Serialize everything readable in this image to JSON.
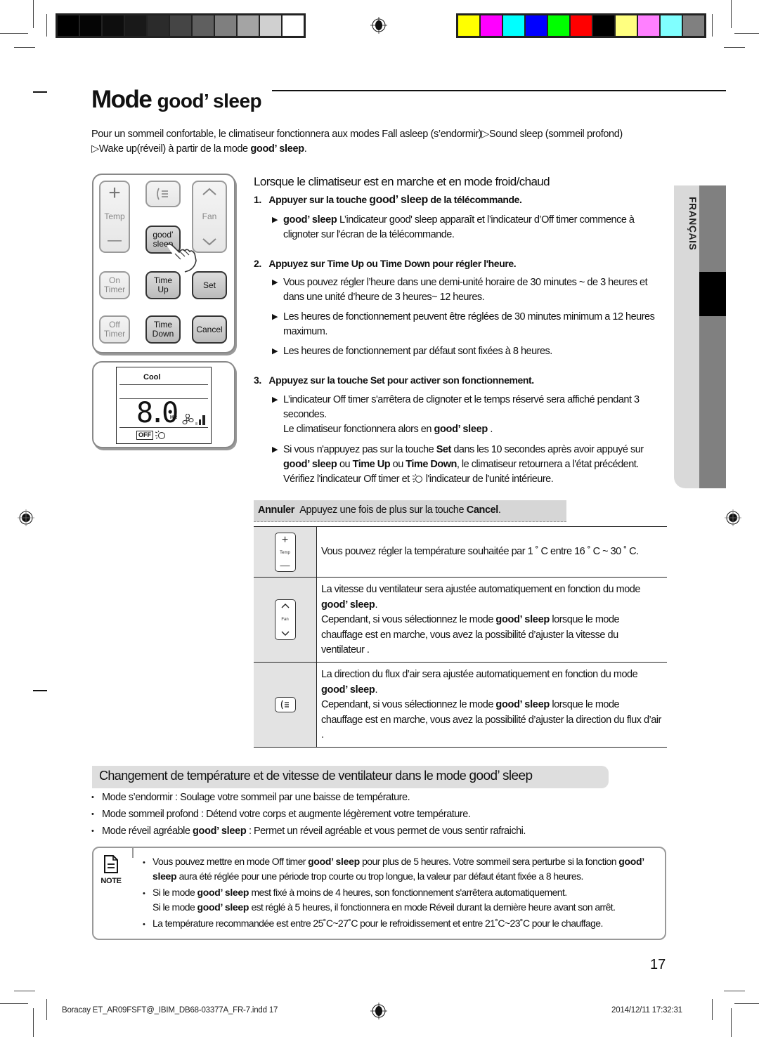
{
  "print_marks": {
    "grayscale_bar": [
      "#000000",
      "#050505",
      "#0e0e0e",
      "#191919",
      "#2b2b2b",
      "#454545",
      "#5f5f5f",
      "#7f7f7f",
      "#a4a4a4",
      "#d0d0d0",
      "#ffffff"
    ],
    "color_bar": [
      "#ffff00",
      "#ff00ff",
      "#00ffff",
      "#0000ff",
      "#00ff00",
      "#ff0000",
      "#000000",
      "#ffff80",
      "#ff80ff",
      "#80ffff",
      "#808080"
    ]
  },
  "title": {
    "prefix": "Mode",
    "brand": "good’ sleep"
  },
  "intro": {
    "text1": "Pour un sommeil confortable, le climatiseur fonctionnera aux modes Fall asleep (s’endormir)",
    "arrow": "▷",
    "text2": "Sound sleep (sommeil profond)",
    "text3": "Wake up(réveil) à partir de la mode ",
    "brand": "good’ sleep",
    "end": "."
  },
  "remote": {
    "buttons": {
      "temp_plus": "+",
      "temp_label": "Temp",
      "temp_minus": "—",
      "swing_symbol": "⟬≋",
      "fan_up": "⌃",
      "fan_label": "Fan",
      "fan_down": "⌄",
      "good_sleep_line1": "good’",
      "good_sleep_line2": "sleep",
      "on_timer_line1": "On",
      "on_timer_line2": "Timer",
      "time_up_line1": "Time",
      "time_up_line2": "Up",
      "set": "Set",
      "off_timer_line1": "Off",
      "off_timer_line2": "Timer",
      "time_down_line1": "Time",
      "time_down_line2": "Down",
      "cancel": "Cancel"
    },
    "display": {
      "mode": "Cool",
      "value": "8.0",
      "unit": "HR",
      "off_badge": "OFF"
    }
  },
  "side_tab": {
    "label": "FRANÇAIS"
  },
  "section1": {
    "heading": "Lorsque le climatiseur est en marche et en mode froid/chaud",
    "steps": [
      {
        "num": "1.",
        "pre": "Appuyer sur la touche ",
        "brand": "good’ sleep",
        "post": " de la télécommande.",
        "bullets": [
          {
            "brand": "good’ sleep",
            "text": " L’indicateur good' sleep apparaît et  l’indicateur d’Off timer commence à clignoter sur l'écran de la télécommande."
          }
        ]
      },
      {
        "num": "2.",
        "text": "Appuyez sur Time Up ou Time Down pour régler l'heure.",
        "bullets": [
          {
            "text": "Vous pouvez régler l’heure dans une demi-unité horaire de 30 minutes ~ de 3 heures et dans une unité d’heure de 3 heures~ 12 heures."
          },
          {
            "text": "Les heures de fonctionnement peuvent être réglées de 30 minutes minimum a 12 heures maximum."
          },
          {
            "text": "Les heures de fonctionnement par défaut sont fixées à 8 heures."
          }
        ]
      },
      {
        "num": "3.",
        "text": "Appuyez sur la touche Set pour activer son fonctionnement.",
        "bullets": [
          {
            "text": "L’indicateur Off timer s'arrêtera de clignoter et le temps réservé sera affiché pendant 3 secondes.",
            "line2_pre": "Le climatiseur fonctionnera alors en ",
            "line2_brand": "good’ sleep",
            "line2_post": " ."
          },
          {
            "p1": "Si vous n'appuyez pas sur la touche ",
            "b1": "Set",
            "p2": " dans les 10 secondes après avoir appuyé sur ",
            "brand": "good’ sleep",
            "p3": " ou ",
            "b2": "Time Up",
            "p4": " ou ",
            "b3": "Time Down",
            "p5": ", le climatiseur retournera a l'état précédent. Vérifiez l'indicateur Off timer et ",
            "p6": " l'indicateur de l'unité intérieure."
          }
        ]
      }
    ]
  },
  "cancel_note": {
    "label": "Annuler",
    "pre": "Appuyez une fois de plus sur la touche ",
    "bold": "Cancel",
    "post": "."
  },
  "table": {
    "rows": [
      {
        "icon": "temp-button-icon",
        "icon_label": "Temp",
        "text": "Vous pouvez régler la température souhaitée par 1 ˚ C entre 16 ˚ C ~ 30 ˚ C."
      },
      {
        "icon": "fan-button-icon",
        "icon_label": "Fan",
        "a": "La vitesse du ventilateur sera ajustée automatiquement en fonction du mode ",
        "brand": "good’ sleep",
        "b": ".",
        "c": "Cependant, si vous sélectionnez le mode ",
        "d": " lorsque le mode chauffage est en marche, vous avez la possibilité d’ajuster la vitesse du ventilateur ."
      },
      {
        "icon": "swing-button-icon",
        "a": "La direction du flux d’air sera ajustée automatiquement en fonction du mode ",
        "brand": "good’ sleep",
        "b": ".",
        "c": "Cependant, si vous sélectionnez le mode ",
        "d": " lorsque le mode chauffage est en marche, vous avez la possibilité d’ajuster la direction du flux d’air ."
      }
    ]
  },
  "section2": {
    "heading": "Changement de température et de vitesse de ventilateur dans le mode ",
    "brand": "good’ sleep",
    "bullets": [
      {
        "text": "Mode s’endormir : Soulage votre sommeil par une baisse de température."
      },
      {
        "text": "Mode sommeil profond : Détend votre corps et augmente légèrement votre température."
      },
      {
        "pre": "Mode réveil agréable ",
        "brand": "good’ sleep",
        "post": " : Permet un réveil agréable et vous permet de vous sentir rafraichi."
      }
    ]
  },
  "note": {
    "label": "NOTE",
    "items": [
      {
        "a": "Vous pouvez mettre en mode Off timer ",
        "brand": "good’ sleep",
        "b": " pour plus de 5 heures. Votre sommeil sera perturbe si la fonction ",
        "c": " aura été réglée pour une période trop courte ou trop longue, la valeur par défaut étant fixée a 8 heures."
      },
      {
        "a": "Si le mode ",
        "brand": "good’ sleep",
        "b": " mest fixé à moins de 4 heures, son fonctionnement s'arrêtera automatiquement.",
        "c": "Si le mode ",
        "d": " est réglé à 5 heures, il fonctionnera en mode Réveil durant la dernière heure avant son arrêt."
      },
      {
        "a": "La température recommandée est entre 25˚C~27˚C pour le refroidissement et entre 21˚C~23˚C pour le chauffage."
      }
    ]
  },
  "page_number": "17",
  "footer": {
    "file": "Boracay ET_AR09FSFT@_IBIM_DB68-03377A_FR-7.indd   17",
    "timestamp": "2014/12/11   17:32:31"
  }
}
